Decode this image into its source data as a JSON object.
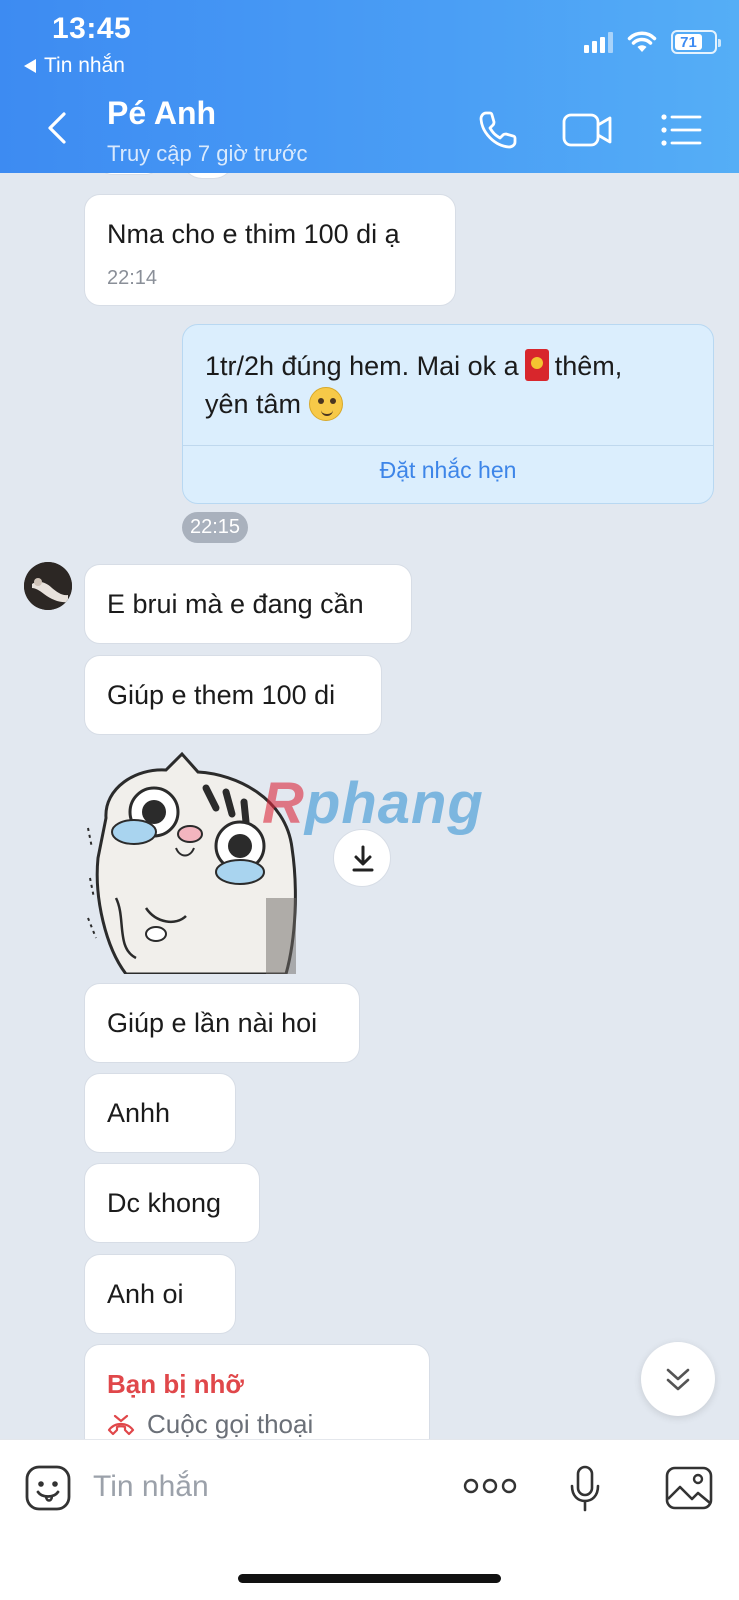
{
  "status_bar": {
    "time": "13:45",
    "back_app": "Tin nhắn",
    "battery": "71"
  },
  "header": {
    "contact_name": "Pé Anh",
    "contact_status": "Truy cập 7 giờ trước",
    "icons": [
      "back-arrow-icon",
      "phone-icon",
      "video-call-icon",
      "menu-list-icon"
    ]
  },
  "messages": [
    {
      "from": "contact",
      "text": "Nma cho e thim 100 di ạ",
      "time": "22:14"
    },
    {
      "from": "me",
      "text_line1_a": "1tr/2h đúng hem. Mai ok a",
      "text_line1_b": "thêm,",
      "text_line2": "yên tâm",
      "action": "Đặt nhắc hẹn",
      "time": "22:15"
    },
    {
      "from": "contact",
      "text": "E brui mà e đang cần"
    },
    {
      "from": "contact",
      "text": "Giúp e them 100 di"
    },
    {
      "from": "contact",
      "type": "sticker",
      "watermark_a": "R",
      "watermark_b": "phang"
    },
    {
      "from": "contact",
      "text": "Giúp e lần nài hoi"
    },
    {
      "from": "contact",
      "text": "Anhh"
    },
    {
      "from": "contact",
      "text": "Dc khong"
    },
    {
      "from": "contact",
      "text": "Anh oi"
    },
    {
      "from": "contact",
      "type": "missed-call",
      "title": "Bạn bị nhỡ",
      "subtitle": "Cuộc gọi thoại"
    }
  ],
  "composer": {
    "placeholder": "Tin nhắn",
    "icons": [
      "sticker-icon",
      "more-options-icon",
      "microphone-icon",
      "image-icon"
    ]
  },
  "colors": {
    "header_blue": "#3d8bf2",
    "chat_bg": "#e2e8f0",
    "my_bubble": "#dbeefd",
    "missed_red": "#e0474a",
    "link_blue": "#3d85e8"
  }
}
